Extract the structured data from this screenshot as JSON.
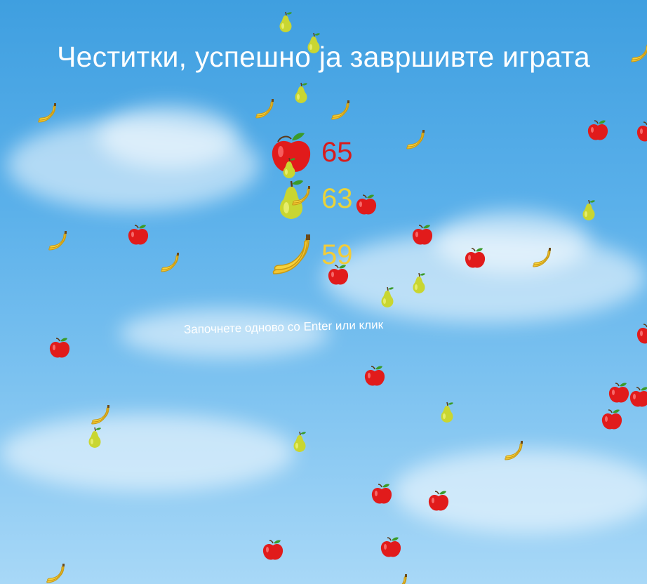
{
  "title": "Честитки, успешно ја завршивте играта",
  "restart_hint": "Започнете одново со Enter или клик",
  "scores": [
    {
      "fruit": "apple",
      "value": "65",
      "color": "#d81c1c"
    },
    {
      "fruit": "pear",
      "value": "63",
      "color": "#e9d33a"
    },
    {
      "fruit": "banana",
      "value": "59",
      "color": "#f2cc3a"
    }
  ],
  "colors": {
    "apple": "#e11b1b",
    "pear": "#c9d631",
    "banana": "#f7d23c",
    "text": "#ffffff"
  }
}
